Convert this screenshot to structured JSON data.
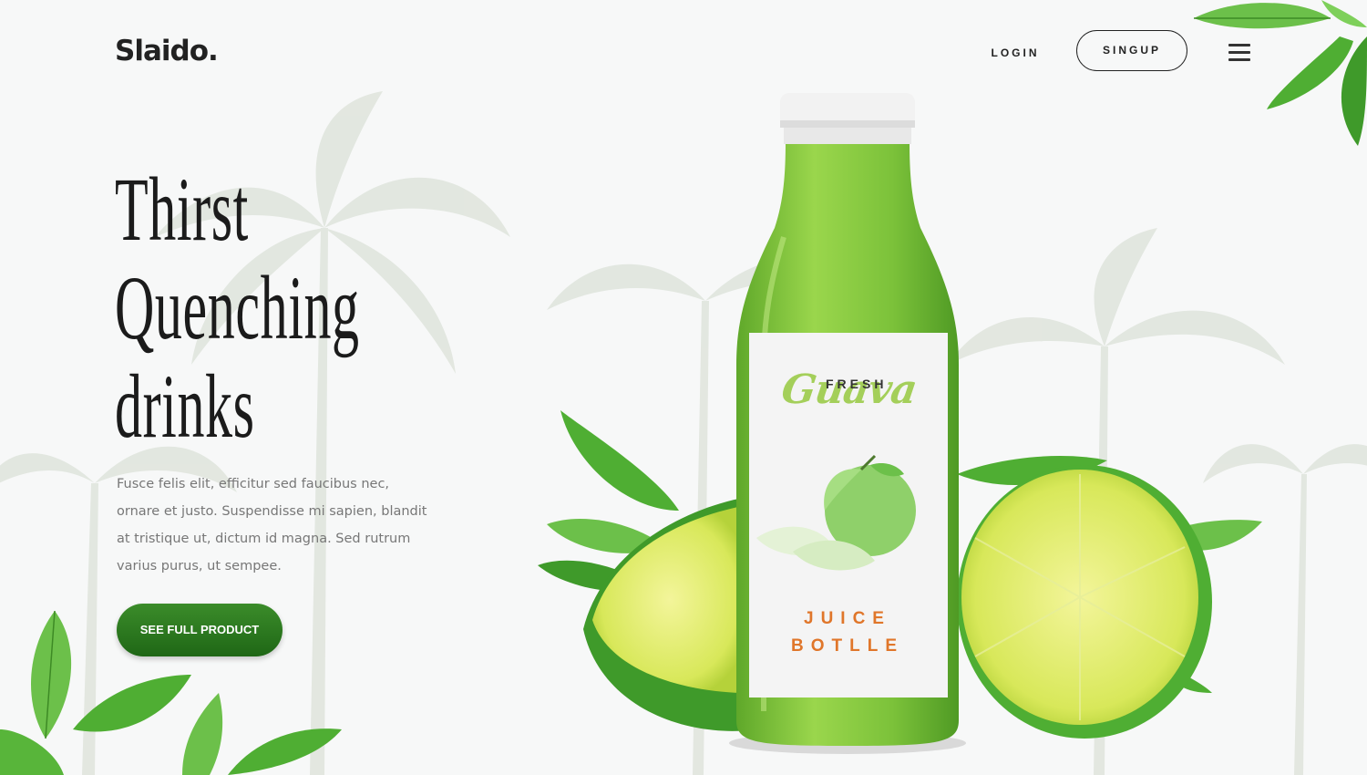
{
  "brand": {
    "logo": "Slaido."
  },
  "nav": {
    "login_label": "LOGIN",
    "signup_label": "SINGUP",
    "menu_icon": "hamburger-menu-icon"
  },
  "hero": {
    "title_lines": [
      "Thirst",
      "Quenching",
      "drinks"
    ],
    "description": "Fusce felis elit, efficitur sed faucibus nec, ornare et justo. Suspendisse mi sapien, blandit at tristique ut, dictum id magna. Sed rutrum varius purus, ut sempee.",
    "cta_label": "SEE FULL PRODUCT"
  },
  "product": {
    "label_top": "FRESH",
    "label_script": "Guava",
    "label_bottom": "JUICE BOTLLE"
  },
  "colors": {
    "text_dark": "#1b1b1b",
    "button_green": "#2a7a1f",
    "bottle_green": "#7fc83a",
    "label_orange": "#e0762a",
    "label_green": "#a4cf5a"
  }
}
